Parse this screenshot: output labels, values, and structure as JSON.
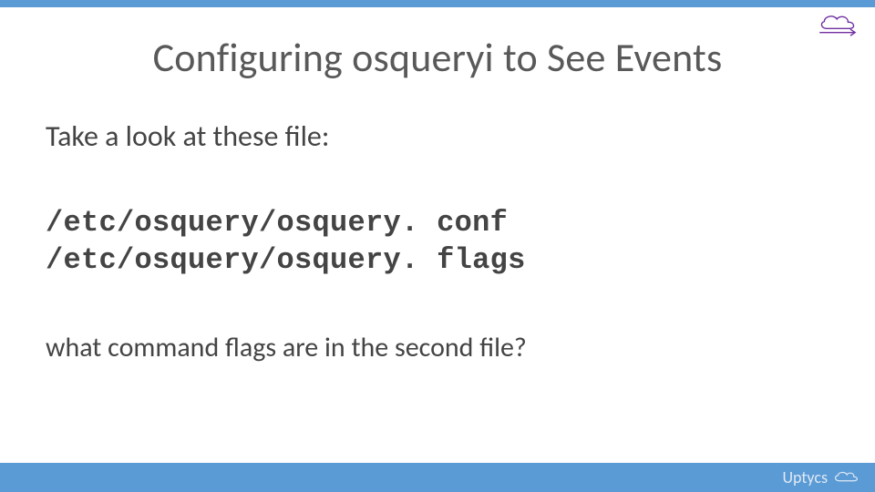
{
  "colors": {
    "accent": "#5b9bd5",
    "text_muted": "#595959",
    "cloud_stroke": "#7030a0",
    "brand_stroke": "#dfe9f5"
  },
  "header": {
    "title": "Configuring osqueryi to See Events"
  },
  "body": {
    "intro": "Take a look at these file:",
    "paths": [
      "/etc/osquery/osquery. conf",
      "/etc/osquery/osquery. flags"
    ],
    "question": "what command flags are in the second file?"
  },
  "footer": {
    "brand": "Uptycs"
  }
}
